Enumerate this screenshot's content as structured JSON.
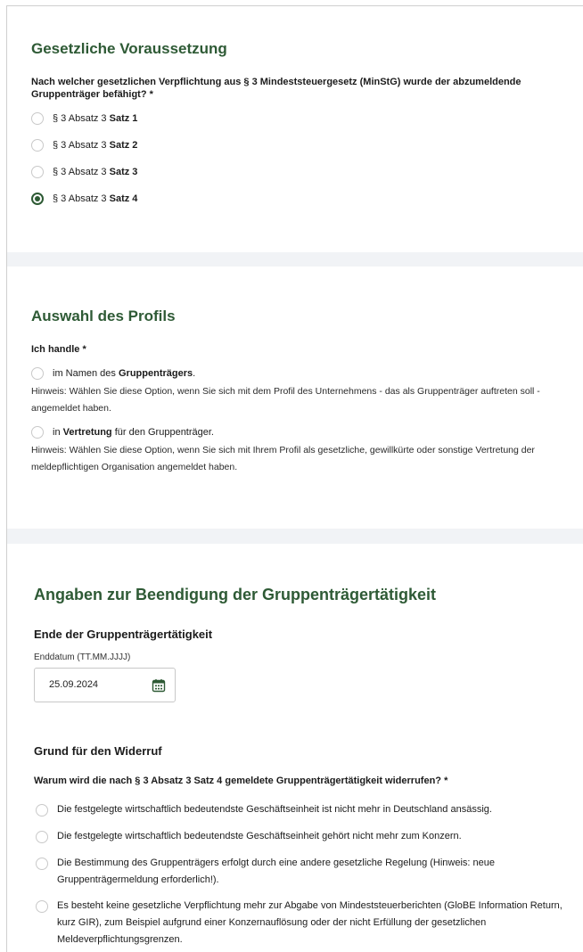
{
  "gesetzlich": {
    "title": "Gesetzliche Voraussetzung",
    "question": "Nach welcher gesetzlichen Verpflichtung aus § 3 Mindeststeuergesetz (MinStG) wurde der abzumeldende Gruppenträger befähigt? *",
    "options": [
      {
        "prefix": "§ 3 Absatz 3 ",
        "bold": "Satz 1",
        "checked": false
      },
      {
        "prefix": "§ 3 Absatz 3 ",
        "bold": "Satz 2",
        "checked": false
      },
      {
        "prefix": "§ 3 Absatz 3 ",
        "bold": "Satz 3",
        "checked": false
      },
      {
        "prefix": "§ 3 Absatz 3 ",
        "bold": "Satz 4",
        "checked": true
      }
    ]
  },
  "profil": {
    "title": "Auswahl des Profils",
    "question": "Ich handle *",
    "option1": {
      "prefix": "im Namen des ",
      "bold": "Gruppenträgers",
      "suffix": "."
    },
    "hint1": "Hinweis: Wählen Sie diese Option, wenn Sie sich mit dem Profil des Unternehmens - das als Gruppenträger auftreten soll - angemeldet haben.",
    "option2": {
      "prefix": "in ",
      "bold": "Vertretung",
      "suffix": " für den Gruppenträger."
    },
    "hint2": "Hinweis: Wählen Sie diese Option, wenn Sie sich mit Ihrem Profil als gesetzliche, gewillkürte oder sonstige Vertretung der meldepflichtigen Organisation angemeldet haben."
  },
  "beendigung": {
    "title": "Angaben zur Beendigung der Gruppenträgertätigkeit",
    "ende_title": "Ende der Gruppenträgertätigkeit",
    "date_label": "Enddatum (TT.MM.JJJJ)",
    "date_value": "25.09.2024",
    "grund_title": "Grund für den Widerruf",
    "grund_question": "Warum wird die nach § 3 Absatz 3 Satz 4 gemeldete Gruppenträgertätigkeit widerrufen? *",
    "reasons": [
      "Die festgelegte wirtschaftlich bedeutendste Geschäftseinheit ist nicht mehr in Deutschland ansässig.",
      "Die festgelegte wirtschaftlich bedeutendste Geschäftseinheit gehört nicht mehr zum Konzern.",
      "Die Bestimmung des Gruppenträgers erfolgt durch eine andere gesetzliche Regelung (Hinweis: neue Gruppenträgermeldung erforderlich!).",
      "Es besteht keine gesetzliche Verpflichtung mehr zur Abgabe von Mindeststeuerberichten (GloBE Information Return, kurz GIR), zum Beispiel aufgrund einer Konzernauflösung oder der nicht Erfüllung der gesetzlichen Meldeverpflichtungsgrenzen."
    ]
  },
  "colors": {
    "accent": "#2e5a35",
    "band": "#f1f3f6",
    "radio_border": "#c9c9c9"
  },
  "icons": {
    "date": "calendar-icon"
  }
}
